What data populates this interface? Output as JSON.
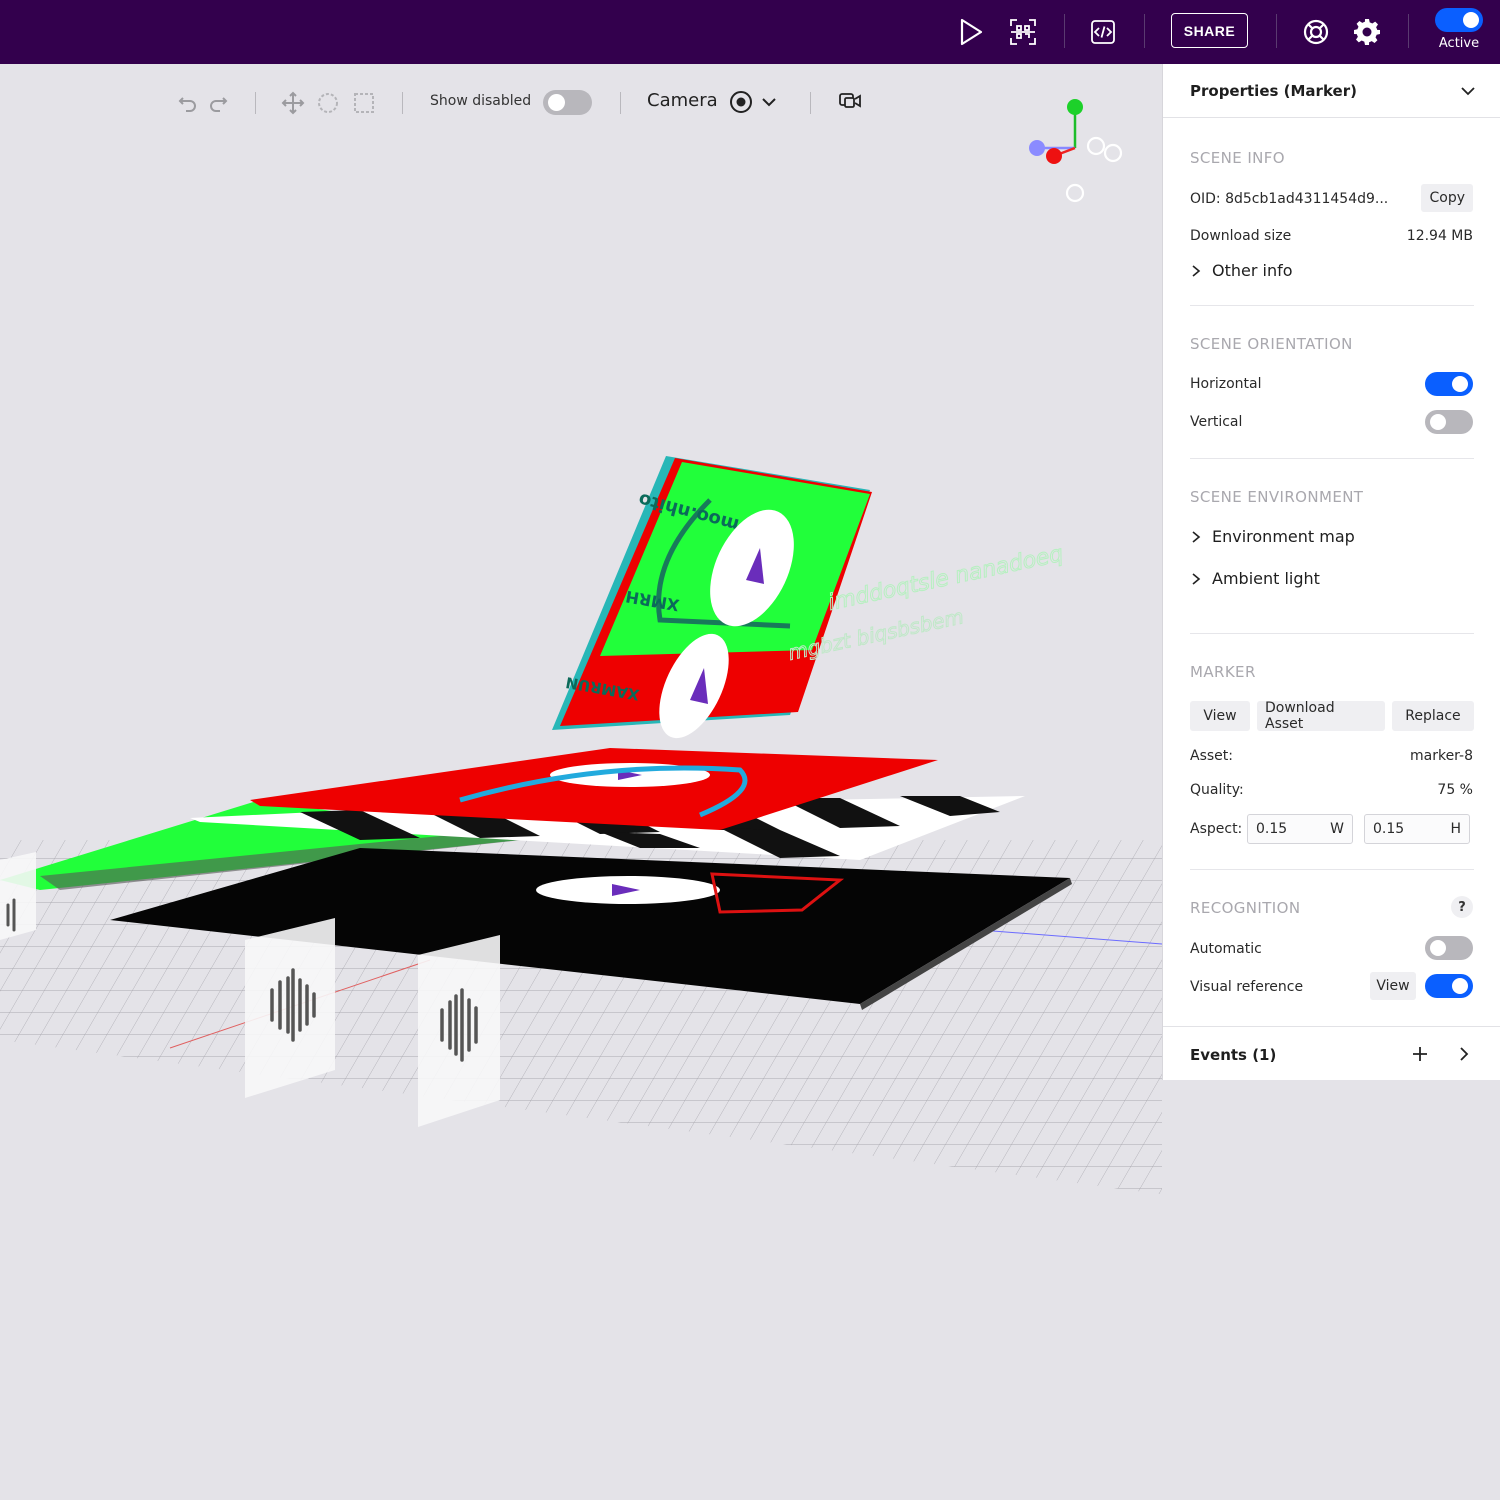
{
  "topbar": {
    "icons": [
      "play-icon",
      "qr-code-icon",
      "code-embed-icon",
      "help-lifebuoy-icon",
      "settings-gear-icon"
    ],
    "share_label": "SHARE",
    "active_label": "Active",
    "active_on": true
  },
  "toolbar": {
    "show_disabled_label": "Show disabled",
    "show_disabled_on": false,
    "camera_label": "Camera"
  },
  "panel": {
    "title": "Properties (Marker)",
    "scene_info": {
      "title": "SCENE INFO",
      "oid_label": "OID: 8d5cb1ad4311454d9...",
      "copy_label": "Copy",
      "download_size_label": "Download size",
      "download_size_value": "12.94 MB",
      "other_info_label": "Other info"
    },
    "scene_orientation": {
      "title": "SCENE ORIENTATION",
      "horizontal_label": "Horizontal",
      "horizontal_on": true,
      "vertical_label": "Vertical",
      "vertical_on": false
    },
    "scene_environment": {
      "title": "SCENE ENVIRONMENT",
      "environment_map_label": "Environment map",
      "ambient_light_label": "Ambient light"
    },
    "marker": {
      "title": "MARKER",
      "view_label": "View",
      "download_asset_label": "Download Asset",
      "replace_label": "Replace",
      "asset_label": "Asset:",
      "asset_value": "marker-8",
      "quality_label": "Quality:",
      "quality_value": "75 %",
      "aspect_label": "Aspect:",
      "aspect_w_value": "0.15",
      "aspect_w_unit": "W",
      "aspect_h_value": "0.15",
      "aspect_h_unit": "H"
    },
    "recognition": {
      "title": "RECOGNITION",
      "help_label": "?",
      "automatic_label": "Automatic",
      "automatic_on": false,
      "visual_reference_label": "Visual reference",
      "visual_reference_view_label": "View",
      "visual_reference_on": true
    },
    "events": {
      "title": "Events (1)"
    }
  },
  "colors": {
    "topbar_bg": "#33004d",
    "accent_blue": "#0a5fff",
    "viewport_bg": "#e4e3e8",
    "marker_green": "#21ff3a",
    "marker_red": "#ff0000"
  }
}
